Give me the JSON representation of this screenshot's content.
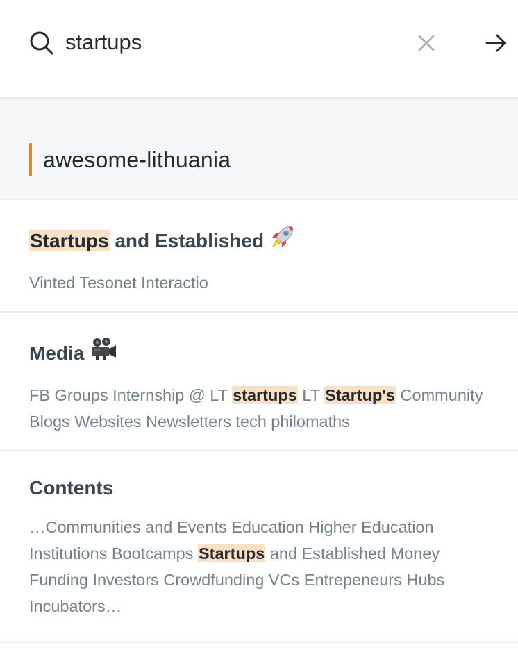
{
  "search": {
    "query": "startups",
    "placeholder": "Search"
  },
  "space": {
    "title": "awesome-lithuania",
    "accent_color": "#d6892f"
  },
  "highlight_color": "#f9dfc4",
  "results": [
    {
      "title_parts": [
        {
          "text": "Startups",
          "hl": true
        },
        {
          "text": " and Established",
          "hl": false
        }
      ],
      "emoji_icon": "rocket-icon",
      "snippet_parts": [
        {
          "text": "Vinted Tesonet Interactio",
          "hl": false
        }
      ]
    },
    {
      "title_parts": [
        {
          "text": "Media",
          "hl": false
        }
      ],
      "emoji_icon": "movie-camera-icon",
      "snippet_parts": [
        {
          "text": "FB Groups Internship @ LT ",
          "hl": false
        },
        {
          "text": "startups",
          "hl": true
        },
        {
          "text": " LT ",
          "hl": false
        },
        {
          "text": "Startup's",
          "hl": true
        },
        {
          "text": " Community Blogs Websites Newsletters tech philomaths",
          "hl": false
        }
      ]
    },
    {
      "title_parts": [
        {
          "text": "Contents",
          "hl": false
        }
      ],
      "emoji_icon": "",
      "snippet_parts": [
        {
          "text": "…Communities and Events Education Higher Education Institutions Bootcamps ",
          "hl": false
        },
        {
          "text": "Startups",
          "hl": true
        },
        {
          "text": " and Established Money Funding Investors Crowdfunding VCs Entrepeneurs Hubs Incubators…",
          "hl": false
        }
      ]
    }
  ]
}
